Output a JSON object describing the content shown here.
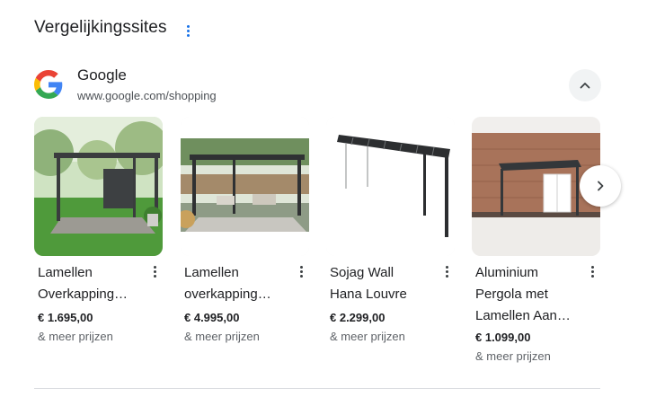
{
  "section": {
    "title": "Vergelijkingssites"
  },
  "source": {
    "name": "Google",
    "url": "www.google.com/shopping",
    "logo_icon": "google-g-logo",
    "brand_colors": {
      "blue": "#4285F4",
      "red": "#EA4335",
      "yellow": "#FBBC05",
      "green": "#34A853"
    }
  },
  "products": [
    {
      "title_line1": "Lamellen",
      "title_line2": "Overkapping…",
      "price": "€ 1.695,00",
      "more": "& meer prijzen",
      "image": "pergola-in-garden-photo"
    },
    {
      "title_line1": "Lamellen",
      "title_line2": "overkapping…",
      "price": "€ 4.995,00",
      "more": "& meer prijzen",
      "image": "pergola-over-patio-photo"
    },
    {
      "title_line1": "Sojag Wall",
      "title_line2": "Hana Louvre",
      "price": "€ 2.299,00",
      "more": "& meer prijzen",
      "image": "wall-pergola-product-photo"
    },
    {
      "title_line1": "Aluminium",
      "title_line2": "Pergola met",
      "title_line3": "Lamellen Aan…",
      "price": "€ 1.099,00",
      "more": "& meer prijzen",
      "image": "pergola-against-brick-wall-photo"
    }
  ],
  "controls": {
    "collapse_icon": "chevron-up-icon",
    "next_icon": "chevron-right-icon",
    "menu_icon": "more-vert-icon"
  },
  "colors": {
    "accent": "#1a73e8",
    "text": "#202124",
    "secondary_text": "#5f6368",
    "divider": "#dadce0"
  }
}
